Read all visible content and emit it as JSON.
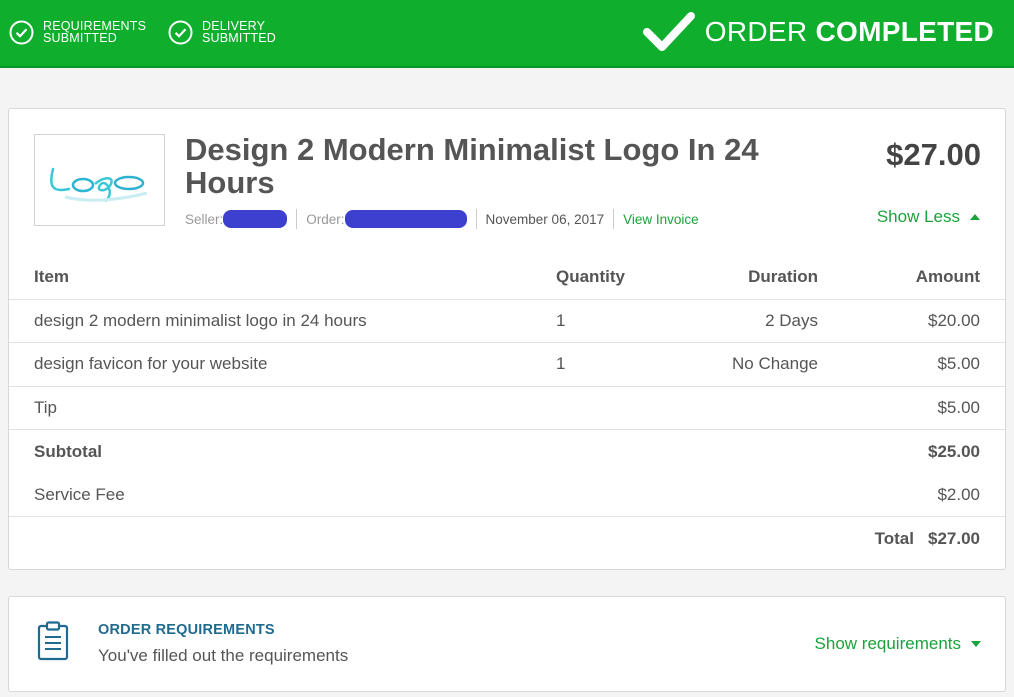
{
  "banner": {
    "step1": {
      "line1": "REQUIREMENTS",
      "line2": "SUBMITTED"
    },
    "step2": {
      "line1": "DELIVERY",
      "line2": "SUBMITTED"
    },
    "status_light": "ORDER",
    "status_bold": "COMPLETED",
    "color": "#0fae2d"
  },
  "order": {
    "title": "Design 2 Modern Minimalist Logo In 24 Hours",
    "price": "$27.00",
    "seller_label": "Seller:",
    "order_label": "Order:",
    "date": "November 06, 2017",
    "view_invoice": "View Invoice",
    "toggle_label": "Show Less",
    "thumbnail_text": "logo"
  },
  "table": {
    "headers": [
      "Item",
      "Quantity",
      "Duration",
      "Amount"
    ],
    "rows": [
      [
        "design 2 modern minimalist logo in 24 hours",
        "1",
        "2 Days",
        "$20.00"
      ],
      [
        "design favicon for your website",
        "1",
        "No Change",
        "$5.00"
      ],
      [
        "Tip",
        "",
        "",
        "$5.00"
      ]
    ],
    "subtotal_label": "Subtotal",
    "subtotal_value": "$25.00",
    "fee_label": "Service Fee",
    "fee_value": "$2.00",
    "total_label": "Total",
    "total_value": "$27.00"
  },
  "requirements": {
    "heading": "ORDER REQUIREMENTS",
    "subtitle": "You've filled out the requirements",
    "toggle_label": "Show requirements",
    "icon": "clipboard-icon"
  },
  "colors": {
    "accent": "#1aa33b",
    "redaction": "#3d3fcf",
    "heading_blue": "#1f6b8f"
  }
}
